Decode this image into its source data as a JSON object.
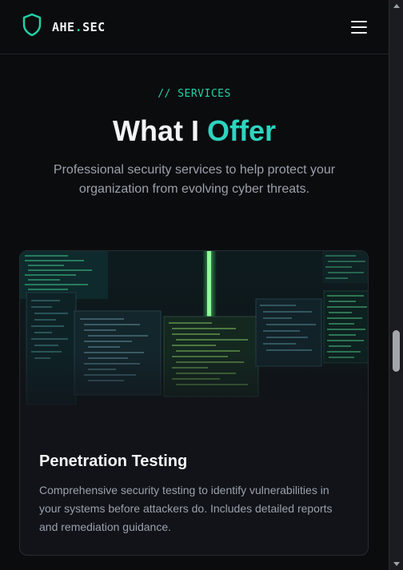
{
  "header": {
    "brand_main": "AHE",
    "brand_dot": ".",
    "brand_suffix": "SEC",
    "logo_icon": "shield-icon",
    "menu_icon": "hamburger-menu-icon"
  },
  "section": {
    "eyebrow": "// SERVICES",
    "title_plain": "What I ",
    "title_accent": "Offer",
    "subtitle": "Professional security services to help protect your organization from evolving cyber threats."
  },
  "card": {
    "image_alt": "monitors showing code in a dark room",
    "title": "Penetration Testing",
    "description": "Comprehensive security testing to identify vulnerabilities in your systems before attackers do. Includes detailed reports and remediation guidance."
  },
  "colors": {
    "accent": "#2dd4bf",
    "accent_green": "#22d3a8",
    "background": "#0b0c0e",
    "card": "#111318"
  }
}
